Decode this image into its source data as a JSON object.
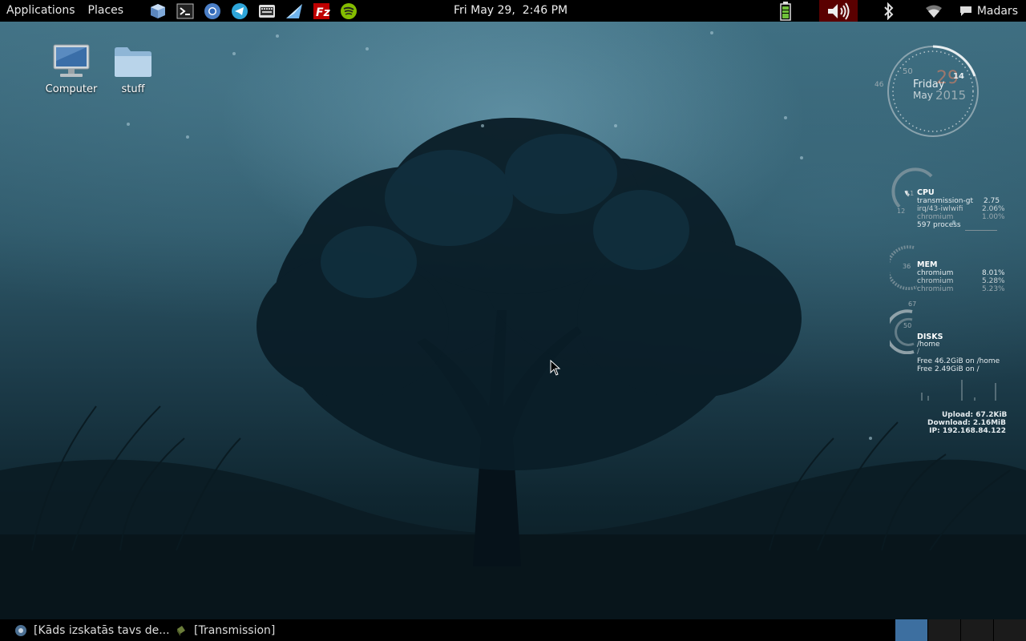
{
  "top_panel": {
    "menus": [
      "Applications",
      "Places"
    ],
    "launchers": [
      "virtualbox-cube-icon",
      "terminal-icon",
      "chromium-icon",
      "telegram-icon",
      "keyboard-app-icon",
      "arrow-app-icon",
      "filezilla-icon",
      "spotify-icon"
    ],
    "clock": "Fri May 29,  2:46 PM",
    "user": "Madars"
  },
  "desktop_icons": [
    {
      "label": "Computer"
    },
    {
      "label": "stuff"
    }
  ],
  "conky": {
    "clock": {
      "day": "Friday",
      "date_num": "29",
      "month": "May",
      "year": "2015",
      "hour_mark": "14",
      "min_mark": "50",
      "sec_mark": "46"
    },
    "cpu": {
      "title": "CPU",
      "gauge_labels": [
        "11",
        "12"
      ],
      "rows": [
        {
          "name": "transmission-gt",
          "value": "2.75"
        },
        {
          "name": "irq/43-iwlwifi",
          "value": "2.06%"
        },
        {
          "name": "chromium",
          "value": "1.00%"
        }
      ],
      "processes": "597 process"
    },
    "mem": {
      "title": "MEM",
      "gauge_label": "36",
      "rows": [
        {
          "name": "chromium",
          "value": "8.01%"
        },
        {
          "name": "chromium",
          "value": "5.28%"
        },
        {
          "name": "chromium",
          "value": "5.23%"
        }
      ]
    },
    "disks": {
      "title": "DISKS",
      "gauge_labels": [
        "67",
        "50"
      ],
      "mounts": [
        "/home",
        "/"
      ],
      "free": [
        "Free 46.2GiB on /home",
        "Free 2.49GiB on /"
      ]
    },
    "net": {
      "upload": "Upload: 67.2KiB",
      "download": "Download: 2.16MiB",
      "ip": "IP: 192.168.84.122"
    }
  },
  "bottom_panel": {
    "tasks": [
      {
        "label": "[Kāds izskatās tavs de..."
      },
      {
        "label": "[Transmission]"
      }
    ],
    "workspaces": 4,
    "active_workspace": 0
  },
  "colors": {
    "panel": "#000000",
    "workspace_active": "#3d6fa0",
    "wallpaper_top": "#3f6f82",
    "wallpaper_bottom": "#0a1a21"
  }
}
